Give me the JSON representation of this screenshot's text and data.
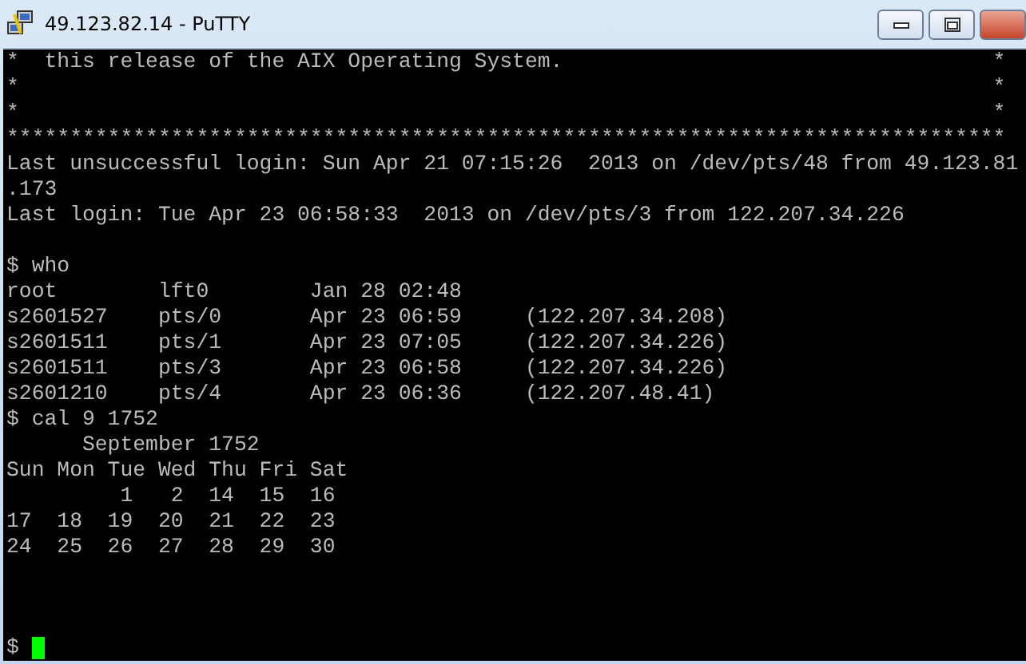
{
  "window": {
    "title": "49.123.82.14 - PuTTY"
  },
  "terminal": {
    "lines": [
      {
        "kind": "framed",
        "left": "*  this release of the AIX Operating System.",
        "right": "*"
      },
      {
        "kind": "framed",
        "left": "*",
        "right": "*"
      },
      {
        "kind": "framed",
        "left": "*",
        "right": "*"
      },
      {
        "kind": "text",
        "text": "*******************************************************************************"
      },
      {
        "kind": "text",
        "text": "Last unsuccessful login: Sun Apr 21 07:15:26  2013 on /dev/pts/48 from 49.123.81"
      },
      {
        "kind": "text",
        "text": ".173"
      },
      {
        "kind": "text",
        "text": "Last login: Tue Apr 23 06:58:33  2013 on /dev/pts/3 from 122.207.34.226"
      },
      {
        "kind": "blank"
      },
      {
        "kind": "text",
        "text": "$ who"
      },
      {
        "kind": "text",
        "text": "root        lft0        Jan 28 02:48"
      },
      {
        "kind": "text",
        "text": "s2601527    pts/0       Apr 23 06:59     (122.207.34.208)"
      },
      {
        "kind": "text",
        "text": "s2601511    pts/1       Apr 23 07:05     (122.207.34.226)"
      },
      {
        "kind": "text",
        "text": "s2601511    pts/3       Apr 23 06:58     (122.207.34.226)"
      },
      {
        "kind": "text",
        "text": "s2601210    pts/4       Apr 23 06:36     (122.207.48.41)"
      },
      {
        "kind": "text",
        "text": "$ cal 9 1752"
      },
      {
        "kind": "text",
        "text": "      September 1752"
      },
      {
        "kind": "text",
        "text": "Sun Mon Tue Wed Thu Fri Sat"
      },
      {
        "kind": "text",
        "text": "         1   2  14  15  16"
      },
      {
        "kind": "text",
        "text": "17  18  19  20  21  22  23"
      },
      {
        "kind": "text",
        "text": "24  25  26  27  28  29  30"
      },
      {
        "kind": "blank"
      },
      {
        "kind": "blank"
      },
      {
        "kind": "blank"
      },
      {
        "kind": "prompt",
        "text": "$",
        "cursor": true
      }
    ]
  }
}
